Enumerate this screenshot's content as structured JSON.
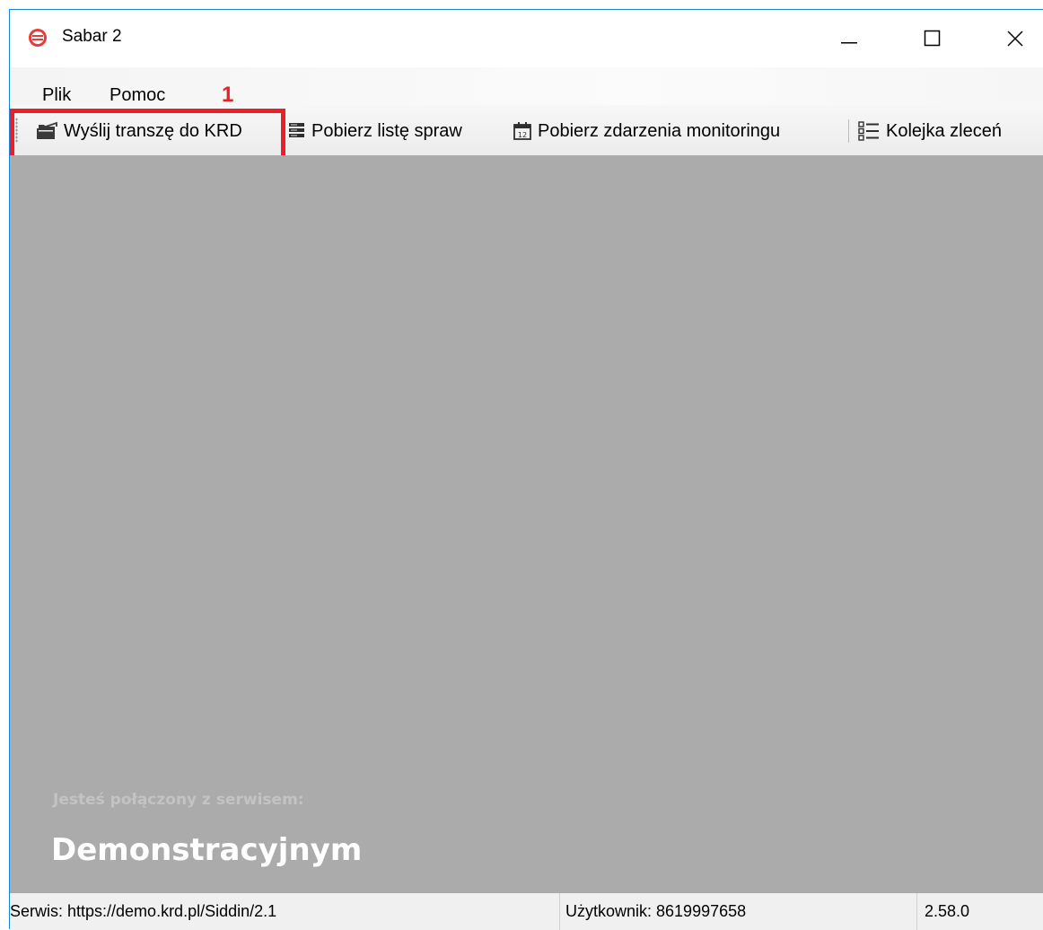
{
  "window": {
    "title": "Sabar 2"
  },
  "menu": {
    "items": [
      {
        "label": "Plik"
      },
      {
        "label": "Pomoc"
      }
    ]
  },
  "annotation": {
    "number": "1",
    "color": "#e8202a"
  },
  "toolbar": {
    "send_label": "Wyślij transzę do KRD",
    "cases_label": "Pobierz listę spraw",
    "events_label": "Pobierz zdarzenia monitoringu",
    "queue_label": "Kolejka zleceń"
  },
  "main": {
    "connected_label": "Jesteś połączony z serwisem:",
    "service_name": "Demonstracyjnym",
    "background": "#ababab"
  },
  "statusbar": {
    "service": "Serwis: https://demo.krd.pl/Siddin/2.1",
    "user": "Użytkownik: 8619997658",
    "version": "2.58.0"
  },
  "icons": {
    "app": "sabar-logo-icon",
    "send": "folder-send-icon",
    "cases": "list-stack-icon",
    "events": "calendar-icon",
    "queue": "queue-list-icon"
  }
}
